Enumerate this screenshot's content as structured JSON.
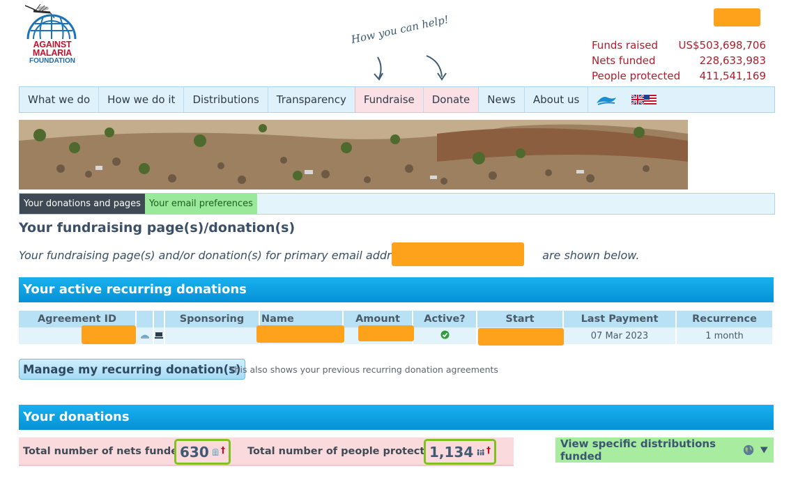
{
  "logo": {
    "line1": "AGAINST",
    "line2": "MALARIA",
    "line3": "FOUNDATION"
  },
  "stats": [
    {
      "label": "Funds raised",
      "value": "US$503,698,706"
    },
    {
      "label": "Nets funded",
      "value": "228,633,983"
    },
    {
      "label": "People protected",
      "value": "411,541,169"
    }
  ],
  "help_annotation": "How you can help!",
  "nav": {
    "items": [
      "What we do",
      "How we do it",
      "Distributions",
      "Transparency",
      "Fundraise",
      "Donate",
      "News",
      "About us"
    ],
    "icons": [
      "wave-icon",
      "uk-us-flag-icon"
    ]
  },
  "subtabs": [
    "Your donations and pages",
    "Your email preferences"
  ],
  "page_title": "Your fundraising page(s)/donation(s)",
  "intro": {
    "before": "Your fundraising page(s) and/or donation(s) for primary email address",
    "after": "are shown below."
  },
  "recurring": {
    "header": "Your active recurring donations",
    "columns": [
      "Agreement ID",
      "",
      "",
      "Sponsoring",
      "Name",
      "Amount",
      "Active?",
      "Start",
      "Last Payment",
      "Recurrence"
    ],
    "row": {
      "last_payment": "07 Mar 2023",
      "recurrence": "1 month"
    }
  },
  "manage_button": "Manage my recurring donation(s)",
  "manage_note": "This also shows your previous recurring donation agreements",
  "donations": {
    "header": "Your donations",
    "nets_label": "Total number of nets funded:",
    "nets_value": "630",
    "people_label": "Total number of people protected",
    "people_value": "1,134",
    "dagger": "†",
    "view_button": "View specific distributions funded"
  },
  "colors": {
    "accent": "#0aa1e6",
    "stats_red": "#b01d2c",
    "highlight_green": "#7fc21f",
    "redaction": "#ffa21b"
  }
}
